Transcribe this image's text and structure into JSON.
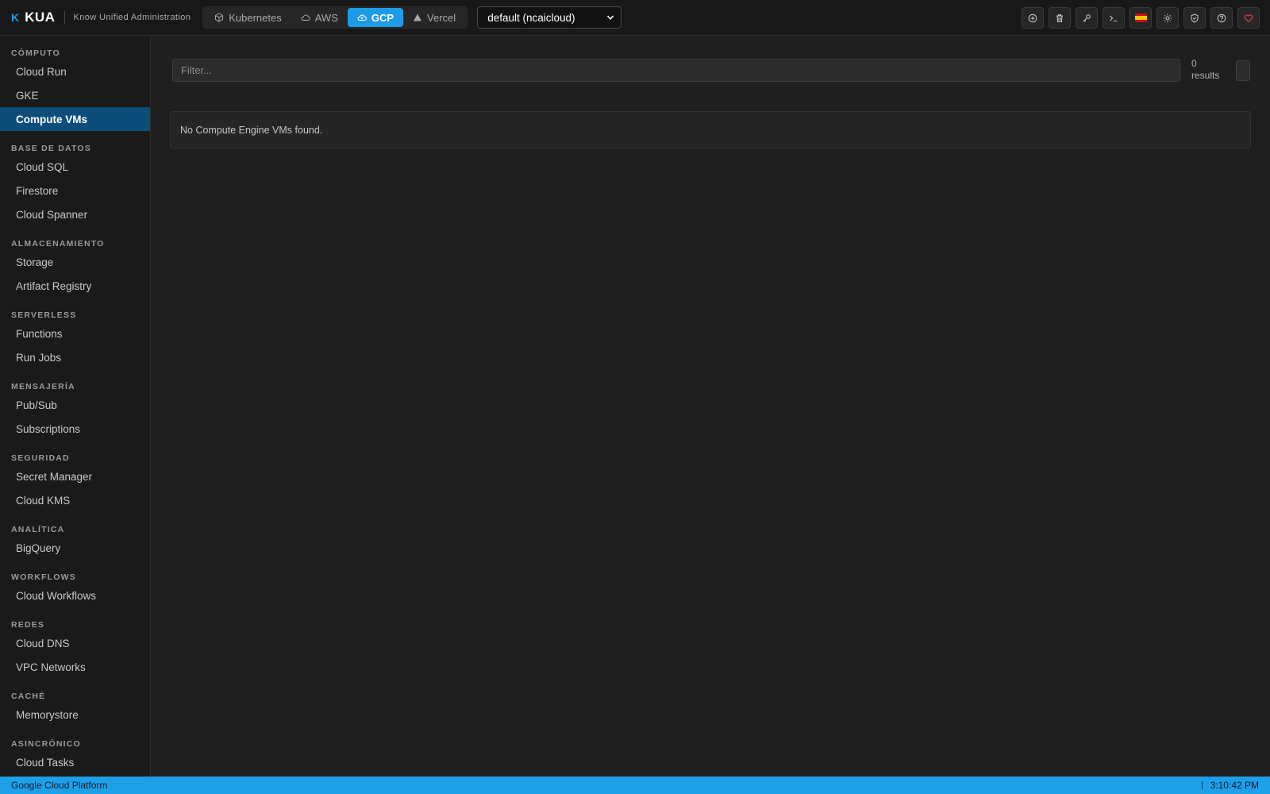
{
  "app": {
    "logo_mark": "K",
    "name": "KUA",
    "subtitle": "Know Unified Administration"
  },
  "providers": [
    {
      "label": "Kubernetes",
      "icon": "cube-icon",
      "active": false
    },
    {
      "label": "AWS",
      "icon": "cloud-icon",
      "active": false
    },
    {
      "label": "GCP",
      "icon": "cloud-upload-icon",
      "active": true
    },
    {
      "label": "Vercel",
      "icon": "triangle-icon",
      "active": false
    }
  ],
  "profile": {
    "selected": "default (ncaicloud)"
  },
  "tools": [
    {
      "name": "add-icon"
    },
    {
      "name": "trash-icon"
    },
    {
      "name": "key-icon"
    },
    {
      "name": "terminal-icon"
    },
    {
      "name": "spain-flag-icon"
    },
    {
      "name": "sun-icon"
    },
    {
      "name": "shield-icon"
    },
    {
      "name": "help-icon"
    },
    {
      "name": "heart-icon"
    }
  ],
  "sidebar": {
    "sections": [
      {
        "title": "CÓMPUTO",
        "items": [
          "Cloud Run",
          "GKE",
          "Compute VMs"
        ]
      },
      {
        "title": "BASE DE DATOS",
        "items": [
          "Cloud SQL",
          "Firestore",
          "Cloud Spanner"
        ]
      },
      {
        "title": "ALMACENAMIENTO",
        "items": [
          "Storage",
          "Artifact Registry"
        ]
      },
      {
        "title": "SERVERLESS",
        "items": [
          "Functions",
          "Run Jobs"
        ]
      },
      {
        "title": "MENSAJERÍA",
        "items": [
          "Pub/Sub",
          "Subscriptions"
        ]
      },
      {
        "title": "SEGURIDAD",
        "items": [
          "Secret Manager",
          "Cloud KMS"
        ]
      },
      {
        "title": "ANALÍTICA",
        "items": [
          "BigQuery"
        ]
      },
      {
        "title": "WORKFLOWS",
        "items": [
          "Cloud Workflows"
        ]
      },
      {
        "title": "REDES",
        "items": [
          "Cloud DNS",
          "VPC Networks"
        ]
      },
      {
        "title": "CACHÉ",
        "items": [
          "Memorystore"
        ]
      },
      {
        "title": "ASINCRÓNICO",
        "items": [
          "Cloud Tasks"
        ]
      }
    ],
    "active_item": "Compute VMs"
  },
  "main": {
    "filter_placeholder": "Filter...",
    "results_count": "0",
    "results_label": "results",
    "empty_message": "No Compute Engine VMs found."
  },
  "status": {
    "left": "Google Cloud Platform",
    "time": "3:10:42 PM"
  },
  "colors": {
    "accent": "#1e9be6",
    "active_nav": "#0e4c7a",
    "heart": "#e0484f"
  }
}
